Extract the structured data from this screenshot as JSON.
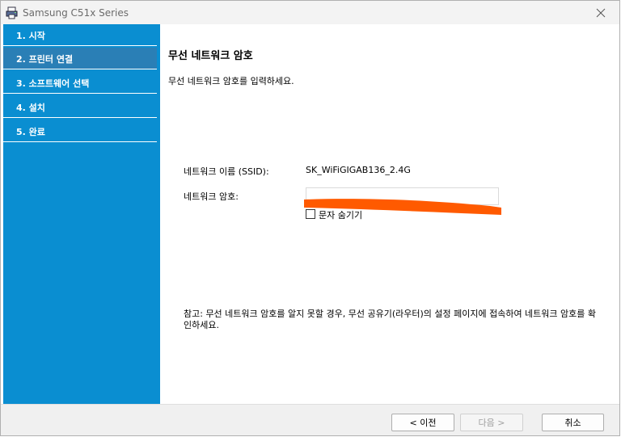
{
  "window": {
    "title": "Samsung C51x Series"
  },
  "steps": [
    {
      "label": "1. 시작"
    },
    {
      "label": "2. 프린터 연결"
    },
    {
      "label": "3. 소프트웨어 선택"
    },
    {
      "label": "4. 설치"
    },
    {
      "label": "5. 완료"
    }
  ],
  "page": {
    "heading": "무선 네트워크 암호",
    "instruction": "무선 네트워크 암호를 입력하세요.",
    "ssid_label": "네트워크 이름 (SSID):",
    "ssid_value": "SK_WiFiGIGAB136_2.4G",
    "password_label": "네트워크 암호:",
    "password_value": "",
    "hide_chars_label": "문자 숨기기",
    "note": "참고: 무선 네트워크 암호를 알지 못할 경우, 무선 공유기(라우터)의 설정 페이지에 접속하여 네트워크 암호를 확인하세요."
  },
  "buttons": {
    "back": "< 이전",
    "next": "다음 >",
    "cancel": "취소"
  },
  "colors": {
    "sidebar": "#0a8ed1",
    "redaction": "#ff5a00"
  }
}
